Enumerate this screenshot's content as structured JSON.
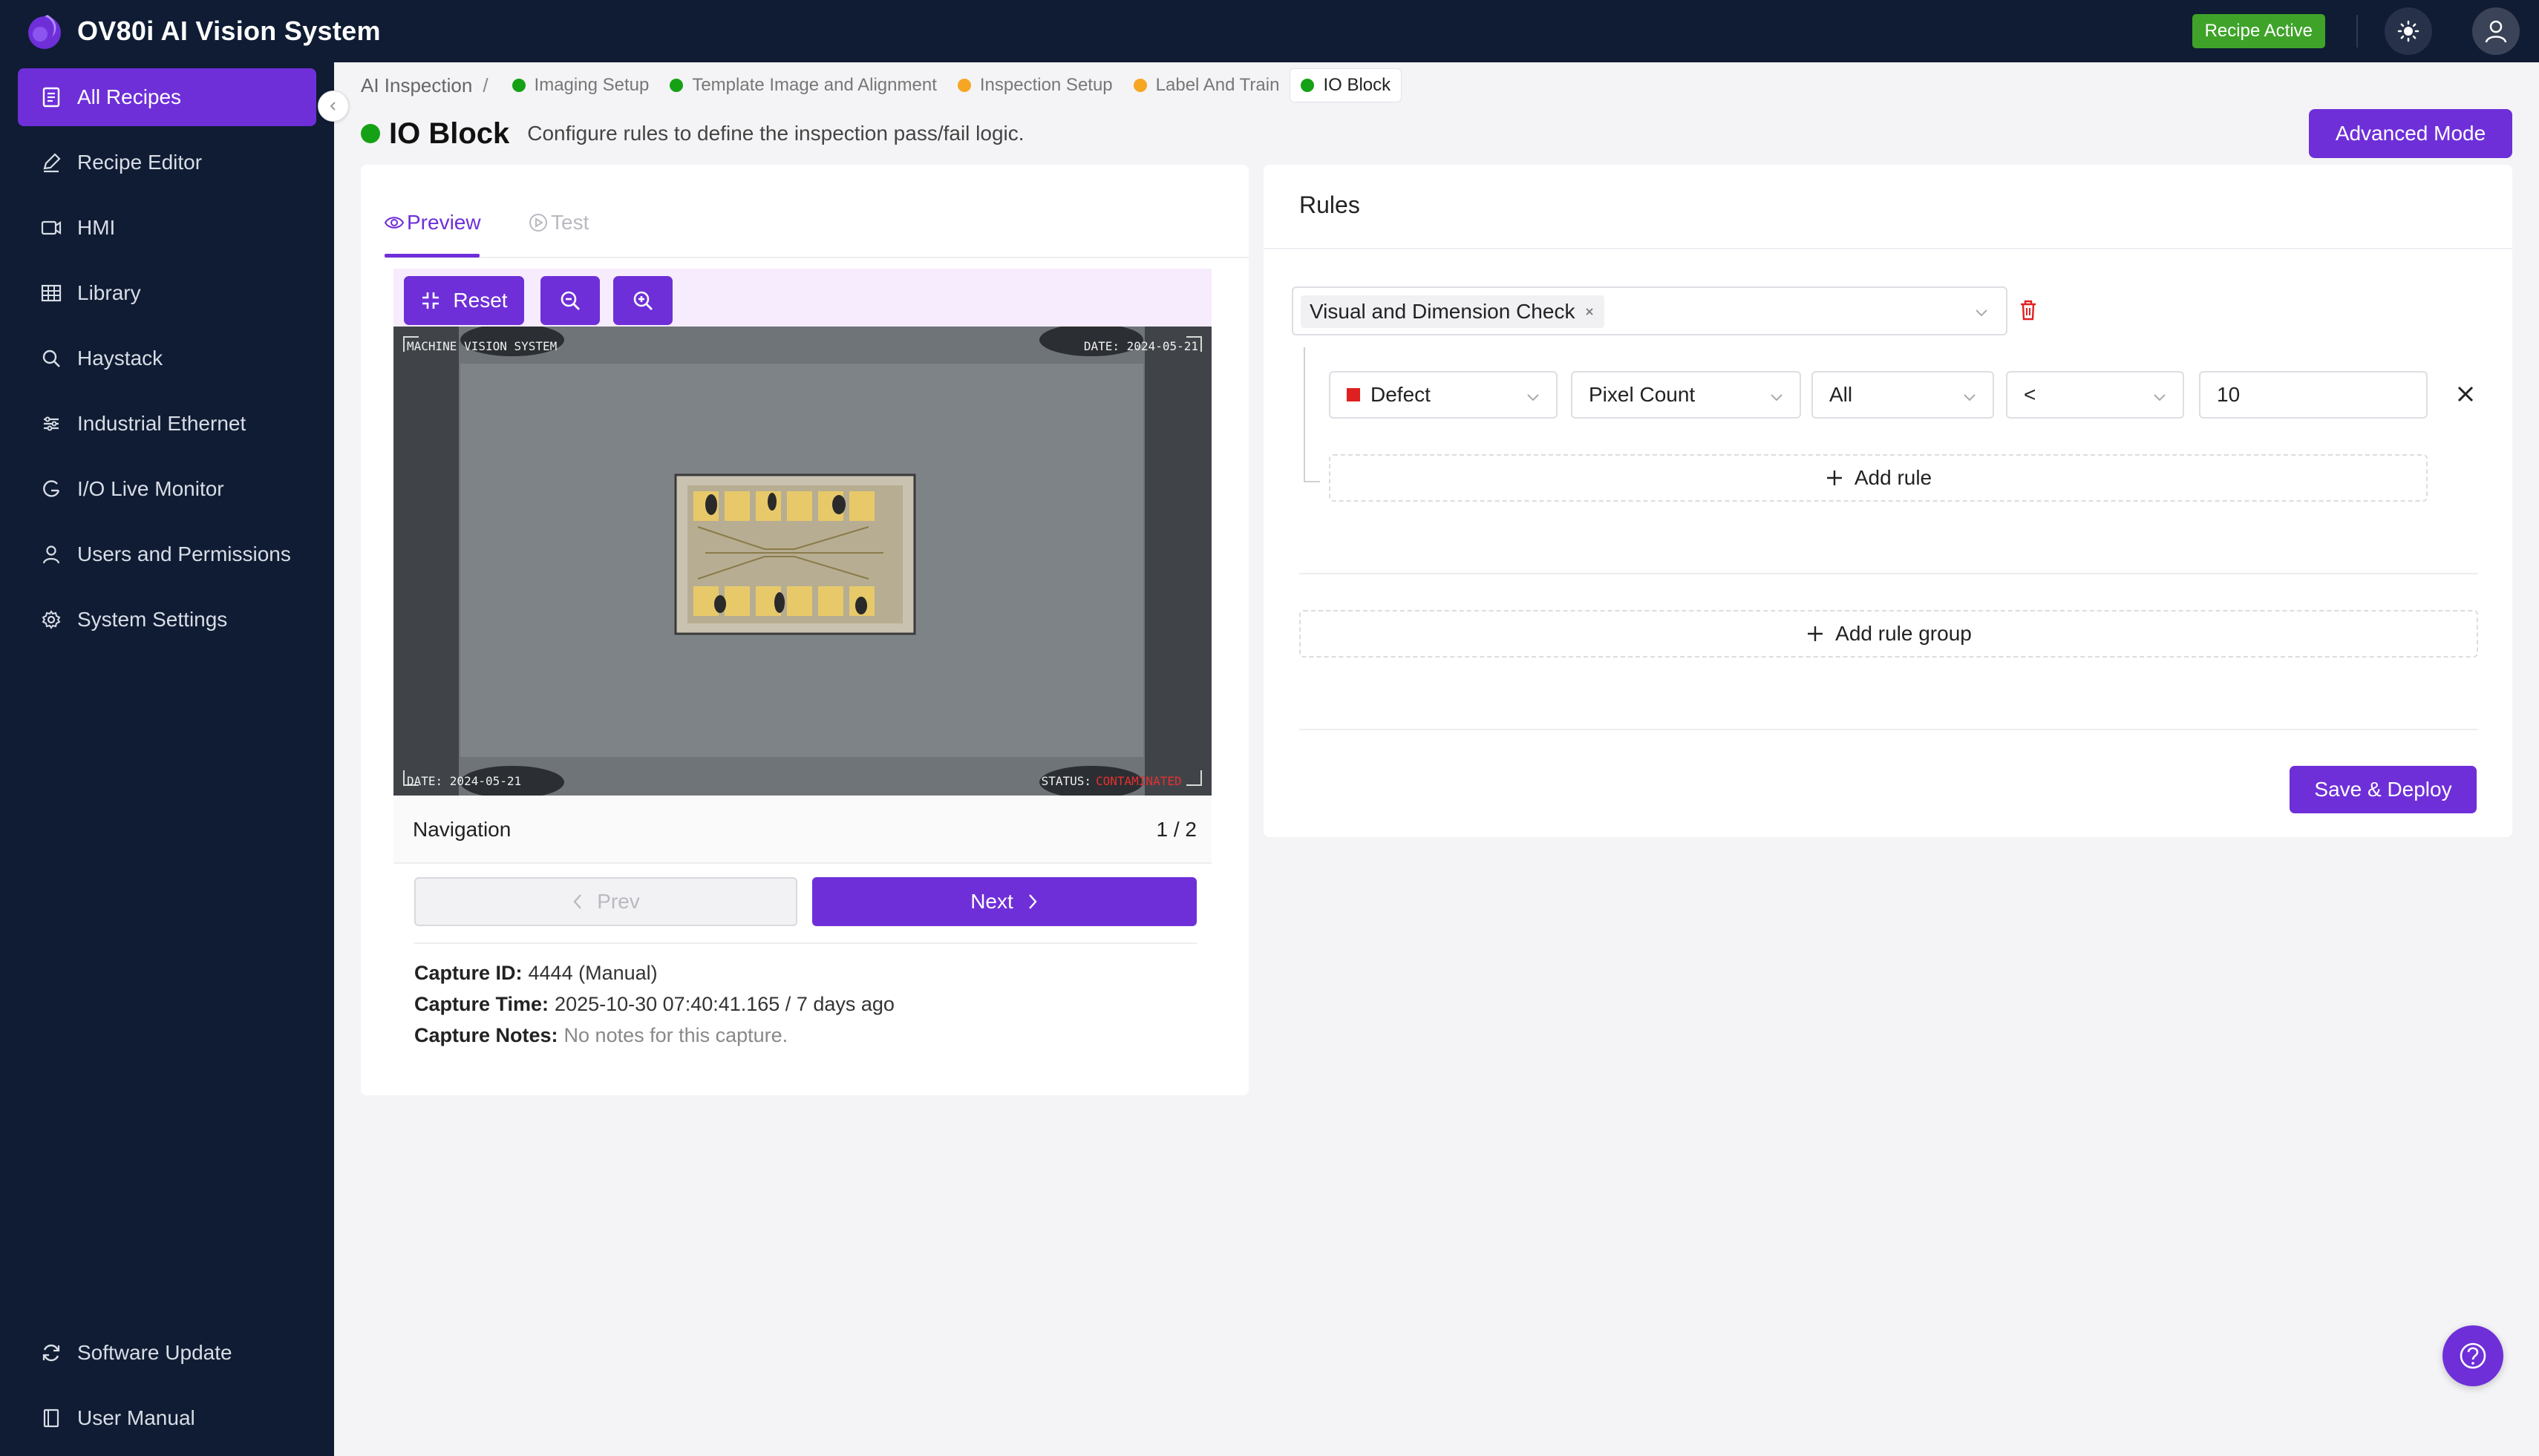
{
  "app": {
    "title": "OV80i AI Vision System",
    "status_badge": "Recipe Active",
    "colors": {
      "accent": "#6e2fd8",
      "nav_bg": "#0f1c33",
      "status_green": "#3fa32a",
      "step_complete": "#15a115",
      "step_pending": "#f5a623",
      "defect_red": "#e02020"
    }
  },
  "sidebar": {
    "items": [
      {
        "label": "All Recipes",
        "icon": "recipes-list-icon",
        "active": true
      },
      {
        "label": "Recipe Editor",
        "icon": "pencil-icon"
      },
      {
        "label": "HMI",
        "icon": "camera-icon"
      },
      {
        "label": "Library",
        "icon": "table-grid-icon"
      },
      {
        "label": "Haystack",
        "icon": "search-icon"
      },
      {
        "label": "Industrial Ethernet",
        "icon": "network-icon"
      },
      {
        "label": "I/O Live Monitor",
        "icon": "monitor-gauge-icon"
      },
      {
        "label": "Users and Permissions",
        "icon": "user-icon"
      },
      {
        "label": "System Settings",
        "icon": "gear-icon"
      }
    ],
    "bottom": [
      {
        "label": "Software Update",
        "icon": "refresh-icon"
      },
      {
        "label": "User Manual",
        "icon": "book-icon"
      }
    ]
  },
  "breadcrumb": {
    "root": "AI Inspection",
    "separator": "/",
    "steps": [
      {
        "label": "Imaging Setup",
        "status": "complete"
      },
      {
        "label": "Template Image and Alignment",
        "status": "complete"
      },
      {
        "label": "Inspection Setup",
        "status": "pending"
      },
      {
        "label": "Label And Train",
        "status": "pending"
      },
      {
        "label": "IO Block",
        "status": "complete",
        "active": true
      }
    ]
  },
  "page": {
    "title": "IO Block",
    "subtitle": "Configure rules to define the inspection pass/fail logic.",
    "advanced_button": "Advanced Mode"
  },
  "preview": {
    "tabs": [
      {
        "label": "Preview",
        "active": true
      },
      {
        "label": "Test",
        "active": false
      }
    ],
    "toolbar": {
      "reset": "Reset"
    },
    "image_overlay": {
      "top_left": "MACHINE VISION SYSTEM",
      "top_right": "DATE: 2024-05-21",
      "bottom_left": "DATE: 2024-05-21",
      "bottom_status_label": "STATUS:",
      "bottom_status_value": "CONTAMINATED"
    },
    "navigation": {
      "label": "Navigation",
      "count": "1 / 2",
      "prev": "Prev",
      "next": "Next"
    },
    "capture": {
      "id_label": "Capture ID:",
      "id_value": "4444 (Manual)",
      "time_label": "Capture Time:",
      "time_value": "2025-10-30 07:40:41.165 / 7 days ago",
      "notes_label": "Capture Notes:",
      "notes_value": "No notes for this capture."
    }
  },
  "rules": {
    "title": "Rules",
    "group": {
      "tag": "Visual and Dimension Check"
    },
    "rule": {
      "class": "Defect",
      "metric": "Pixel Count",
      "scope": "All",
      "operator": "<",
      "value": "10"
    },
    "add_rule": "Add rule",
    "add_rule_group": "Add rule group",
    "save_button": "Save & Deploy"
  }
}
